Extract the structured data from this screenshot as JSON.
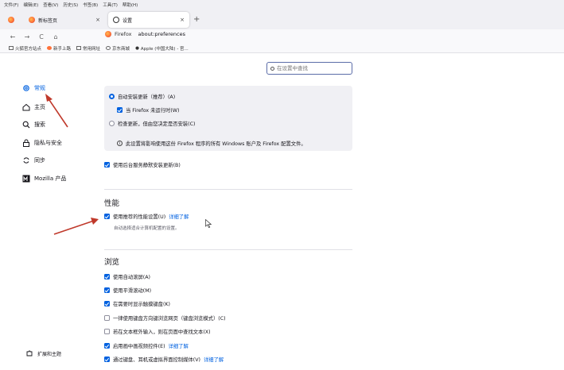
{
  "menubar": [
    "文件(F)",
    "编辑(E)",
    "查看(V)",
    "历史(S)",
    "书签(B)",
    "工具(T)",
    "帮助(H)"
  ],
  "tabs": [
    {
      "label": "新标签页",
      "close": "×"
    },
    {
      "label": "设置",
      "close": "×"
    }
  ],
  "new_tab": "+",
  "nav": {
    "back": "←",
    "forward": "→",
    "reload": "C",
    "home": "⌂"
  },
  "url": {
    "site": "Firefox",
    "path": "about:preferences"
  },
  "bookmarks": [
    "火狐官方站点",
    "新手上路",
    "常用网址",
    "京东商城",
    "Apple (中国大陆) - 官..."
  ],
  "search": {
    "placeholder": "在设置中查找"
  },
  "sidebar": {
    "items": [
      {
        "label": "常规",
        "icon": "gear-icon"
      },
      {
        "label": "主页",
        "icon": "home-icon"
      },
      {
        "label": "搜索",
        "icon": "search-icon"
      },
      {
        "label": "隐私与安全",
        "icon": "lock-icon"
      },
      {
        "label": "同步",
        "icon": "sync-icon"
      },
      {
        "label": "Mozilla 产品",
        "icon": "mozilla-icon"
      }
    ],
    "extensions": "扩展和主题"
  },
  "updates": {
    "auto_install": "自动安装更新（推荐）(A)",
    "when_not_running": "当 Firefox 未运行时(W)",
    "check_only": "检查更新，但由您决定是否安装(C)",
    "info": "此设置将影响使用这份 Firefox 程序的所有 Windows 账户及 Firefox 配置文件。",
    "background_service": "使用后台服务静默安装更新(B)"
  },
  "performance": {
    "heading": "性能",
    "recommended": "使用推荐的性能设置(U)",
    "learn_more": "详细了解",
    "description": "自动选择适合计算机配置的设置。"
  },
  "browsing": {
    "heading": "浏览",
    "items": [
      {
        "label": "使用自动滚屏(A)",
        "checked": true
      },
      {
        "label": "使用平滑滚动(M)",
        "checked": true
      },
      {
        "label": "在需要时显示触摸键盘(K)",
        "checked": true
      },
      {
        "label": "一律使用键盘方向键浏览网页（键盘浏览模式）(C)",
        "checked": false
      },
      {
        "label": "若在文本框外输入，则在页面中查找文本(X)",
        "checked": false
      },
      {
        "label": "启用画中画视频控件(E)",
        "checked": true,
        "link": "详细了解"
      },
      {
        "label": "通过键盘、耳机或虚拟界面控制媒体(V)",
        "checked": true,
        "link": "详细了解"
      }
    ]
  },
  "colors": {
    "accent": "#0061e0",
    "annotation_arrow": "#c0392b"
  }
}
